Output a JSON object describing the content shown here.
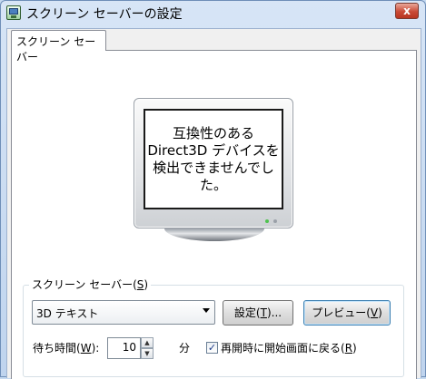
{
  "window": {
    "title": "スクリーン セーバーの設定",
    "close_glyph": "x"
  },
  "tabs": [
    {
      "label": "スクリーン セーバー"
    }
  ],
  "preview": {
    "message_lines": [
      "互換性のある",
      "Direct3D デバイスを",
      "検出できませんでし",
      "た。"
    ]
  },
  "screensaver_group": {
    "legend_pre": "スクリーン セーバー(",
    "legend_key": "S",
    "legend_post": ")",
    "selected": "3D テキスト"
  },
  "buttons": {
    "settings_pre": "設定(",
    "settings_key": "T",
    "settings_post": ")...",
    "preview_pre": "プレビュー(",
    "preview_key": "V",
    "preview_post": ")"
  },
  "wait": {
    "label_pre": "待ち時間(",
    "label_key": "W",
    "label_post": "):",
    "value": "10",
    "unit": "分"
  },
  "resume": {
    "checked": true,
    "check_glyph": "✓",
    "label_pre": "再開時に開始画面に戻る(",
    "label_key": "R",
    "label_post": ")"
  }
}
